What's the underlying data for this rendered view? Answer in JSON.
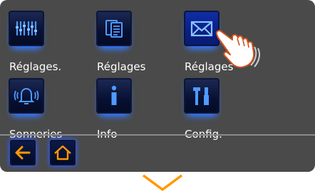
{
  "menu": {
    "items": [
      {
        "label": "Réglages.",
        "icon": "equalizer-icon",
        "selected": false
      },
      {
        "label": "Réglages",
        "icon": "clipboard-icon",
        "selected": false
      },
      {
        "label": "Réglages",
        "icon": "envelope-icon",
        "selected": true
      },
      {
        "label": "Sonneries",
        "icon": "bell-icon",
        "selected": false
      },
      {
        "label": "Info",
        "icon": "info-icon",
        "selected": false
      },
      {
        "label": "Config.",
        "icon": "tools-icon",
        "selected": false
      }
    ]
  },
  "nav": {
    "back_icon": "arrow-left-icon",
    "home_icon": "home-icon",
    "scroll_icon": "scroll-down-icon"
  },
  "colors": {
    "background": "#4a4a4a",
    "icon_blue": "#3d8bff",
    "nav_orange": "#ff9900",
    "label_text": "#ffffff"
  }
}
